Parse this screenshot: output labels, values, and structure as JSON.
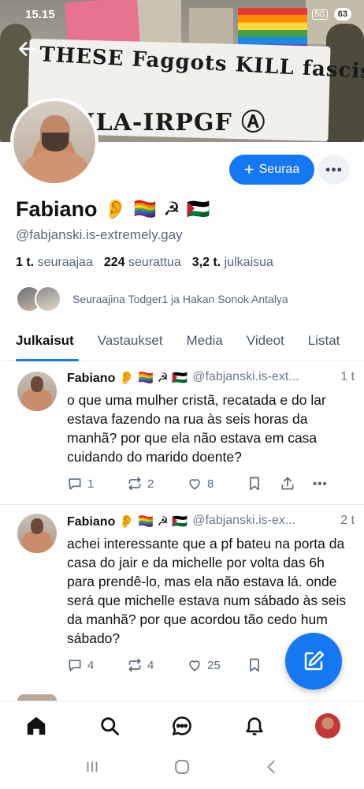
{
  "status_bar": {
    "time": "15.15",
    "badge": "5G",
    "battery": "63"
  },
  "banner": {
    "line1": "THESE Faggots KILL fascists",
    "line2": "TQILA-IRPGF Ⓐ"
  },
  "profile": {
    "name": "Fabiano",
    "name_emojis": [
      "👂",
      "🏳️‍🌈",
      "☭",
      "🇵🇸"
    ],
    "handle": "@fabjanski.is-extremely.gay",
    "follow_label": "Seuraa",
    "followers_count": "1 t.",
    "followers_label": "seuraajaa",
    "following_count": "224",
    "following_label": "seurattua",
    "posts_count": "3,2 t.",
    "posts_label": "julkaisua",
    "followed_by": "Seuraajina Todger1 ja Hakan Sonok Antalya"
  },
  "tabs": [
    "Julkaisut",
    "Vastaukset",
    "Media",
    "Videot",
    "Listat"
  ],
  "posts": [
    {
      "author": "Fabiano 👂 🏳️‍🌈 ☭ 🇵🇸",
      "handle": "@fabjanski.is-ext...",
      "time": "1 t",
      "text": "o que uma mulher cristã, recatada e do lar estava fazendo na rua às seis horas da manhã? por que ela não estava em casa cuidando do marido doente?",
      "replies": "1",
      "reposts": "2",
      "likes": "8"
    },
    {
      "author": "Fabiano 👂 🏳️‍🌈 ☭ 🇵🇸",
      "handle": "@fabjanski.is-ex...",
      "time": "2 t",
      "text": "achei interessante que a pf bateu na porta da casa do jair e da michelle por volta das 6h para prendê-lo, mas ela não estava lá. onde será que michelle estava num sábado às seis da manhã? por que acordou tão cedo hum sábado?",
      "replies": "4",
      "reposts": "4",
      "likes": "25"
    }
  ],
  "icons": {
    "back": "arrow-left-icon",
    "compose": "pencil-square-icon",
    "nav": [
      "home-icon",
      "search-icon",
      "chat-icon",
      "bell-icon",
      "profile-avatar"
    ],
    "system_nav": [
      "recents-icon",
      "home-circle-icon",
      "back-chevron-icon"
    ]
  },
  "colors": {
    "accent": "#1677f2",
    "muted": "#586777"
  }
}
